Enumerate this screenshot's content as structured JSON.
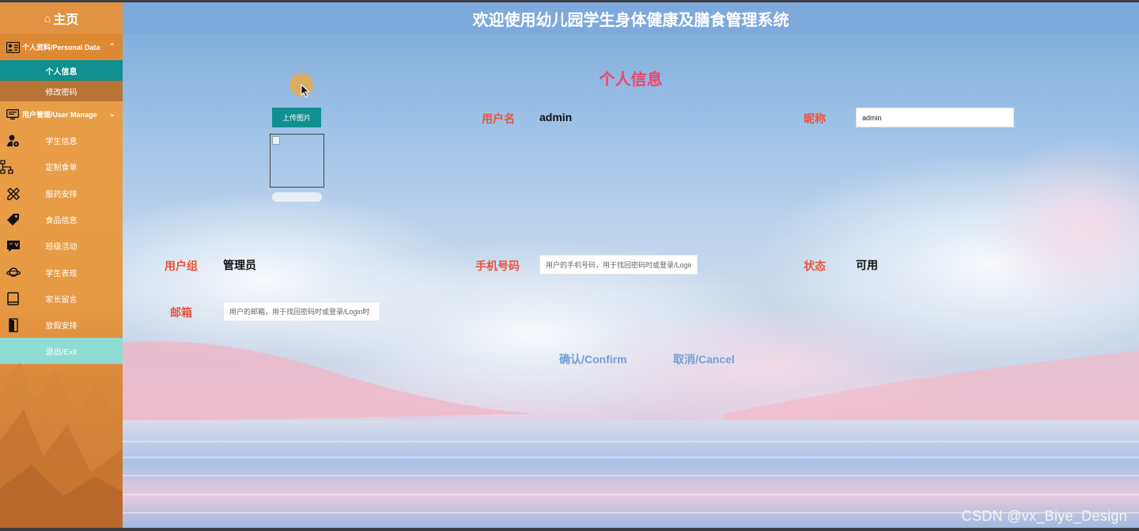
{
  "sidebar": {
    "home_glyph": "⌂",
    "home_label": "主页",
    "sections": [
      {
        "label": "个人资料/Personal Data",
        "icon": "id-card-icon",
        "chevron": "⌃"
      },
      {
        "label": "用户管理/User Manage",
        "icon": "monitor-icon",
        "chevron": "⌄"
      }
    ],
    "sub_items": [
      "个人信息",
      "修改密码"
    ],
    "nav_items": [
      {
        "label": "学生信息",
        "icon": "user-gear-icon"
      },
      {
        "label": "定制食单",
        "icon": "sitemap-icon"
      },
      {
        "label": "服药安排",
        "icon": "pencil-ruler-icon"
      },
      {
        "label": "食品信息",
        "icon": "tag-icon"
      },
      {
        "label": "班级活动",
        "icon": "chat-icon"
      },
      {
        "label": "学生表现",
        "icon": "planet-icon"
      },
      {
        "label": "家长留言",
        "icon": "book-icon"
      },
      {
        "label": "放假安排",
        "icon": "door-icon"
      }
    ],
    "exit_label": "退出/Exit"
  },
  "header": {
    "title": "欢迎使用幼儿园学生身体健康及膳食管理系统"
  },
  "form": {
    "page_title": "个人信息",
    "upload_label": "上传图片",
    "username_label": "用户名",
    "username_value": "admin",
    "nickname_label": "昵称",
    "nickname_value": "admin",
    "group_label": "用户组",
    "group_value": "管理员",
    "phone_label": "手机号码",
    "phone_placeholder": "用户的手机号码，用于找回密码时或登录/Login",
    "status_label": "状态",
    "status_value": "可用",
    "email_label": "邮箱",
    "email_placeholder": "用户的邮箱，用于找回密码时或登录/Login时",
    "confirm_label": "确认/Confirm",
    "cancel_label": "取消/Cancel"
  },
  "watermark": "CSDN @vx_Biye_Design",
  "colors": {
    "sidebar_orange": "#e9a049",
    "teal": "#0f8f8f",
    "exit_teal": "#8fdcd3",
    "header_blue": "#7ea9dc",
    "title_red": "#f0436a",
    "label_red": "#e8543b",
    "action_blue": "#6f9fd8"
  }
}
